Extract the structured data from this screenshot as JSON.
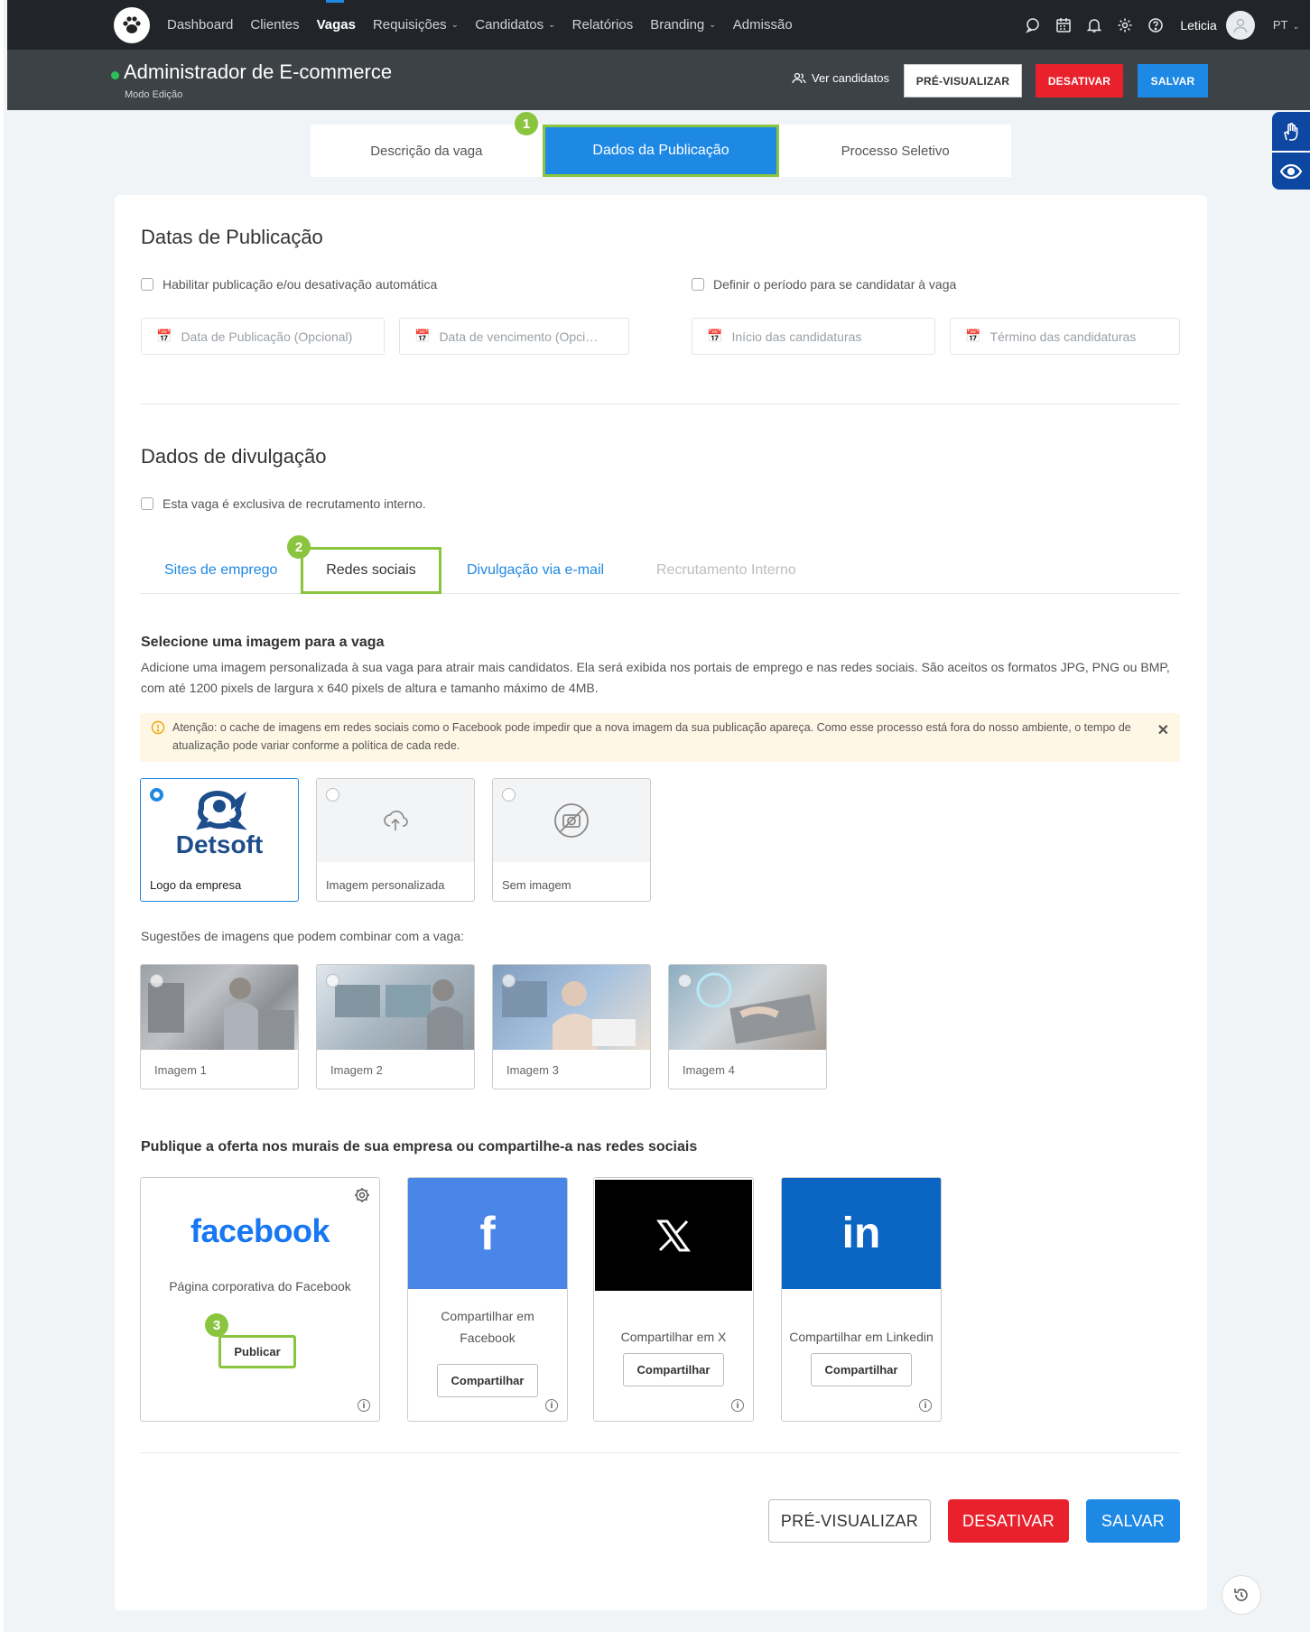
{
  "nav": {
    "items": [
      {
        "label": "Dashboard",
        "dropdown": false,
        "active": false
      },
      {
        "label": "Clientes",
        "dropdown": false,
        "active": false
      },
      {
        "label": "Vagas",
        "dropdown": false,
        "active": true
      },
      {
        "label": "Requisições",
        "dropdown": true,
        "active": false
      },
      {
        "label": "Candidatos",
        "dropdown": true,
        "active": false
      },
      {
        "label": "Relatórios",
        "dropdown": false,
        "active": false
      },
      {
        "label": "Branding",
        "dropdown": true,
        "active": false
      },
      {
        "label": "Admissão",
        "dropdown": false,
        "active": false
      }
    ],
    "user": "Leticia",
    "lang": "PT",
    "icons": [
      "chat-icon",
      "calendar-icon",
      "bell-icon",
      "gear-icon",
      "help-icon"
    ]
  },
  "header": {
    "title": "Administrador de E-commerce",
    "mode": "Modo Edição",
    "ver_candidatos": "Ver candidatos",
    "preview": "PRÉ-VISUALIZAR",
    "deactivate": "DESATIVAR",
    "save": "SALVAR"
  },
  "tabs": [
    "Descrição da vaga",
    "Dados da Publicação",
    "Processo Seletivo"
  ],
  "steps": {
    "one": "1",
    "two": "2",
    "three": "3"
  },
  "pub_dates": {
    "title": "Datas de Publicação",
    "auto_check": "Habilitar publicação e/ou desativação automática",
    "period_check": "Definir o período para se candidatar à vaga",
    "ph_pub": "Data de Publicação (Opcional)",
    "ph_exp": "Data de vencimento (Opci…",
    "ph_start": "Início das candidaturas",
    "ph_end": "Término das candidaturas"
  },
  "divulg": {
    "title": "Dados de divulgação",
    "internal_check": "Esta vaga é exclusiva de recrutamento interno.",
    "subtabs": [
      "Sites de emprego",
      "Redes sociais",
      "Divulgação via e-mail",
      "Recrutamento Interno"
    ]
  },
  "image": {
    "title": "Selecione uma imagem para a vaga",
    "desc": "Adicione uma imagem personalizada à sua vaga para atrair mais candidatos. Ela será exibida nos portais de emprego e nas redes sociais. São aceitos os formatos JPG, PNG ou BMP, com até 1200 pixels de largura x 640 pixels de altura e tamanho máximo de 4MB.",
    "alert": "Atenção: o cache de imagens em redes sociais como o Facebook pode impedir que a nova imagem da sua publicação apareça. Como esse processo está fora do nosso ambiente, o tempo de atualização pode variar conforme a política de cada rede.",
    "options": [
      "Logo da empresa",
      "Imagem personalizada",
      "Sem imagem"
    ],
    "logo_text": "Detsoft",
    "suggest_label": "Sugestões de imagens que podem combinar com a vaga:",
    "suggestions": [
      "Imagem 1",
      "Imagem 2",
      "Imagem 3",
      "Imagem 4"
    ]
  },
  "social": {
    "title": "Publique a oferta nos murais de sua empresa ou compartilhe-a nas redes sociais",
    "fb_brand": "facebook",
    "fb_page": "Página corporativa do Facebook",
    "publish": "Publicar",
    "share": "Compartilhar",
    "cards": [
      "Compartilhar em Facebook",
      "Compartilhar em X",
      "Compartilhar em Linkedin"
    ],
    "colors": {
      "facebook": "#4a86e8",
      "x": "#000000",
      "linkedin": "#0a66c2"
    }
  },
  "footer": {
    "preview": "PRÉ-VISUALIZAR",
    "deactivate": "DESATIVAR",
    "save": "SALVAR"
  },
  "colors": {
    "primary": "#1e88e5",
    "danger": "#e8212d",
    "highlight": "#8bc53f",
    "nav": "#212529"
  }
}
